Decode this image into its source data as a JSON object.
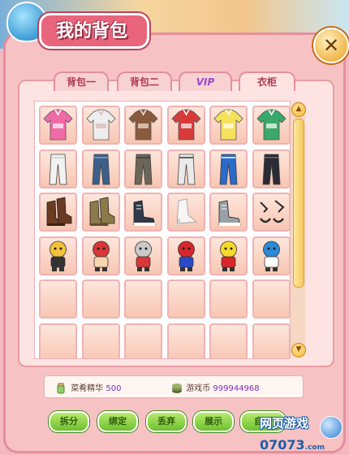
{
  "window": {
    "title": "我的背包",
    "close_label": "✕"
  },
  "tabs": [
    {
      "label": "背包一",
      "active": false
    },
    {
      "label": "背包二",
      "active": false
    },
    {
      "label": "VIP",
      "active": false
    },
    {
      "label": "衣柜",
      "active": true
    }
  ],
  "grid": {
    "rows": [
      [
        {
          "name": "pink-hoodie",
          "icon": "hoodie",
          "color": "#f16aa8",
          "accent": "#ffffff"
        },
        {
          "name": "white-jacket",
          "icon": "jacket",
          "color": "#eeeeee",
          "accent": "#d8b4b4"
        },
        {
          "name": "brown-coat",
          "icon": "coat",
          "color": "#8a5a3c",
          "accent": "#f0e4d8"
        },
        {
          "name": "red-checker-shirt",
          "icon": "shirt",
          "color": "#d83a3a",
          "accent": "#ffffff"
        },
        {
          "name": "yellow-print-shirt",
          "icon": "shirt",
          "color": "#f6e15a",
          "accent": "#ffffff"
        },
        {
          "name": "green-stripe-shirt",
          "icon": "shirt",
          "color": "#3aa86a",
          "accent": "#ffffff"
        }
      ],
      [
        {
          "name": "white-pants",
          "icon": "pants",
          "color": "#f2f2f2",
          "accent": "#cccccc"
        },
        {
          "name": "blue-jeans",
          "icon": "pants",
          "color": "#3c5f8a",
          "accent": "#7fa0c0"
        },
        {
          "name": "cargo-pants",
          "icon": "pants",
          "color": "#6b6658",
          "accent": "#3d3a33"
        },
        {
          "name": "plaid-pants",
          "icon": "pants",
          "color": "#eaeaea",
          "accent": "#333333"
        },
        {
          "name": "blue-track-pants",
          "icon": "pants",
          "color": "#2a6ac8",
          "accent": "#ffffff"
        },
        {
          "name": "black-jeans",
          "icon": "pants",
          "color": "#2b2b33",
          "accent": "#6b6b7a"
        }
      ],
      [
        {
          "name": "brown-boots",
          "icon": "boot",
          "color": "#6a3b22",
          "accent": "#3d2212"
        },
        {
          "name": "khaki-boots",
          "icon": "boot",
          "color": "#8c7a48",
          "accent": "#5e5030"
        },
        {
          "name": "dark-sneakers",
          "icon": "sneaker",
          "color": "#2f3a4a",
          "accent": "#ffffff"
        },
        {
          "name": "white-heels",
          "icon": "heel",
          "color": "#f6f6f6",
          "accent": "#d0d0d0"
        },
        {
          "name": "grey-sneakers",
          "icon": "sneaker",
          "color": "#9aa0a8",
          "accent": "#ffffff"
        },
        {
          "name": "black-sandals",
          "icon": "sandal",
          "color": "#2a2a2a",
          "accent": "#555555"
        }
      ],
      [
        {
          "name": "yellow-mech-doll",
          "icon": "doll",
          "color": "#f2c23a",
          "accent": "#333333"
        },
        {
          "name": "crayon-boy-doll",
          "icon": "doll",
          "color": "#d93838",
          "accent": "#f6d6b0"
        },
        {
          "name": "ultraman-doll",
          "icon": "doll",
          "color": "#c9c9c9",
          "accent": "#d93838"
        },
        {
          "name": "mario-doll",
          "icon": "doll",
          "color": "#d8262a",
          "accent": "#2a4ac8"
        },
        {
          "name": "pikachu-doll",
          "icon": "doll",
          "color": "#f7d92a",
          "accent": "#d8262a"
        },
        {
          "name": "doraemon-doll",
          "icon": "doll",
          "color": "#2a8ad8",
          "accent": "#ffffff"
        }
      ],
      [
        {
          "name": "empty",
          "icon": "empty"
        },
        {
          "name": "empty",
          "icon": "empty"
        },
        {
          "name": "empty",
          "icon": "empty"
        },
        {
          "name": "empty",
          "icon": "empty"
        },
        {
          "name": "empty",
          "icon": "empty"
        },
        {
          "name": "empty",
          "icon": "empty"
        }
      ],
      [
        {
          "name": "empty",
          "icon": "empty"
        },
        {
          "name": "empty",
          "icon": "empty"
        },
        {
          "name": "empty",
          "icon": "empty"
        },
        {
          "name": "empty",
          "icon": "empty"
        },
        {
          "name": "empty",
          "icon": "empty"
        },
        {
          "name": "empty",
          "icon": "empty"
        }
      ]
    ]
  },
  "scroll": {
    "up_icon": "arrow-up-icon",
    "down_icon": "arrow-down-icon",
    "up_label": "▲",
    "down_label": "▼"
  },
  "currency": {
    "essence_label": "菜肴精华",
    "essence_value": "500",
    "coin_label": "游戏币",
    "coin_value": "999944968"
  },
  "buttons": [
    {
      "label": "拆分"
    },
    {
      "label": "绑定"
    },
    {
      "label": "丢弃"
    },
    {
      "label": "展示"
    },
    {
      "label": "自动"
    }
  ],
  "watermark": {
    "line1": "网页游戏",
    "line2": "07073",
    "line2_suffix": ".com"
  },
  "colors": {
    "panel": "#f7c2c4",
    "border": "#e58f9c",
    "button_green": "#6cbf2f",
    "title_pink": "#e9657c"
  }
}
